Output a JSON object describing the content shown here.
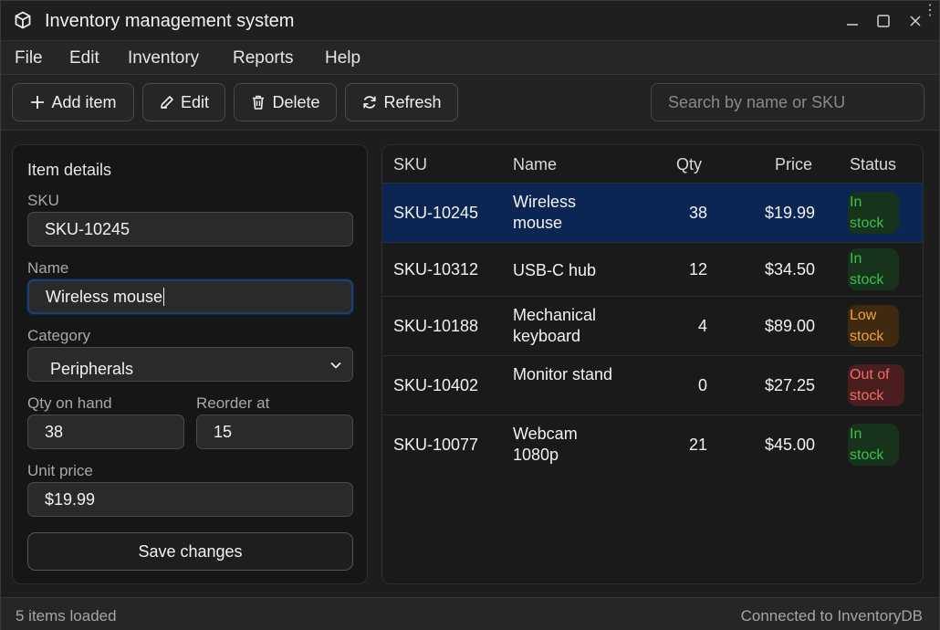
{
  "window": {
    "title": "Inventory management system",
    "icon": "cube-icon",
    "corner_indicator": "⋮⋮"
  },
  "menu": [
    "File",
    "Edit",
    "Inventory",
    "Reports",
    "Help"
  ],
  "toolbar": {
    "add_label": "Add item",
    "edit_label": "Edit",
    "delete_label": "Delete",
    "refresh_label": "Refresh",
    "search_placeholder": "Search by name or SKU"
  },
  "details": {
    "title": "Item details",
    "sku_label": "SKU",
    "sku_value": "SKU-10245",
    "name_label": "Name",
    "name_value": "Wireless mouse",
    "category_label": "Category",
    "category_value": "Peripherals",
    "qty_label": "Qty on hand",
    "qty_value": "38",
    "reorder_label": "Reorder at",
    "reorder_value": "15",
    "price_label": "Unit price",
    "price_value": "$19.99",
    "save_label": "Save changes"
  },
  "table": {
    "headers": [
      "SKU",
      "Name",
      "Qty",
      "Price",
      "Status"
    ],
    "rows": [
      {
        "sku": "SKU-10245",
        "name": "Wireless mouse",
        "qty": "38",
        "price": "$19.99",
        "status": "In stock",
        "status_kind": "in",
        "selected": true
      },
      {
        "sku": "SKU-10312",
        "name": "USB-C hub",
        "qty": "12",
        "price": "$34.50",
        "status": "In stock",
        "status_kind": "in",
        "selected": false
      },
      {
        "sku": "SKU-10188",
        "name": "Mechanical keyboard",
        "qty": "4",
        "price": "$89.00",
        "status": "Low stock",
        "status_kind": "low",
        "selected": false
      },
      {
        "sku": "SKU-10402",
        "name": "Monitor stand",
        "qty": "0",
        "price": "$27.25",
        "status": "Out of stock",
        "status_kind": "out",
        "selected": false
      },
      {
        "sku": "SKU-10077",
        "name": "Webcam 1080p",
        "qty": "21",
        "price": "$45.00",
        "status": "In stock",
        "status_kind": "in",
        "selected": false
      }
    ]
  },
  "status": {
    "left": "5 items loaded",
    "right": "Connected to InventoryDB"
  },
  "colors": {
    "selected_row": "#0b2653",
    "in_stock": "#3bbf4e",
    "low_stock": "#f0a33a",
    "out_of_stock": "#f06b6b"
  }
}
